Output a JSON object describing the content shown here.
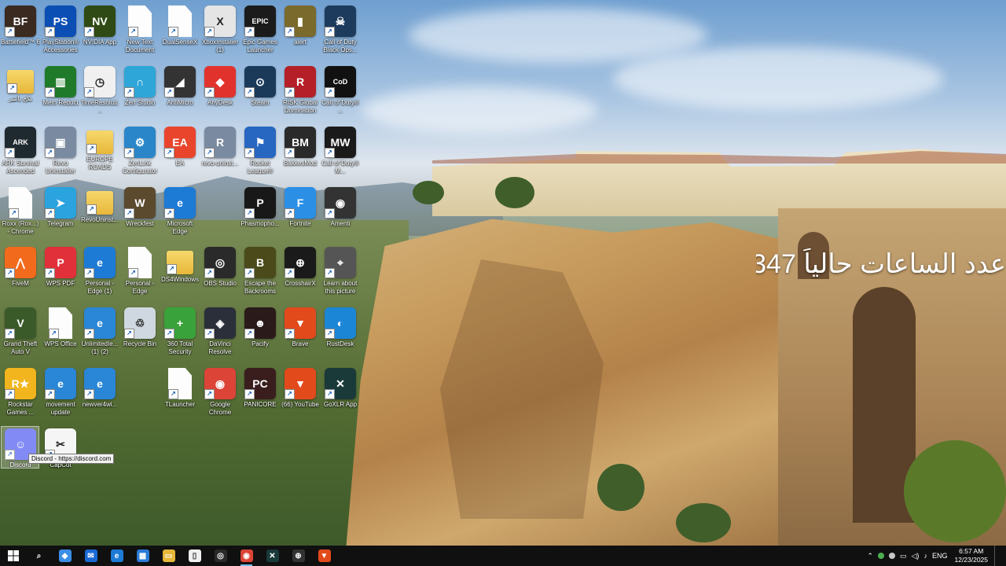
{
  "overlay_text": "عدد الساعات حالياً 347",
  "tooltip": "Discord - https://discord.com",
  "desktop_icons": [
    {
      "label": "Battlefield™ 6",
      "color": "#3a2a20",
      "glyph": "BF",
      "col": 0,
      "row": 0
    },
    {
      "label": "PlayStation® Accessories",
      "color": "#0b4fb5",
      "glyph": "PS",
      "col": 1,
      "row": 0
    },
    {
      "label": "NVIDIA App",
      "color": "#2f4a14",
      "glyph": "NV",
      "col": 2,
      "row": 0
    },
    {
      "label": "New Text Document",
      "color": "doc",
      "glyph": "",
      "col": 3,
      "row": 0
    },
    {
      "label": "DualSenseX",
      "color": "doc",
      "glyph": "",
      "col": 4,
      "row": 0
    },
    {
      "label": "XboxInstaller (1)",
      "color": "#e5e5e5",
      "glyph": "X",
      "col": 5,
      "row": 0
    },
    {
      "label": "Epic Games Launcher",
      "color": "#1b1b1b",
      "glyph": "EPIC",
      "col": 6,
      "row": 0
    },
    {
      "label": "alert",
      "color": "#7a6a2b",
      "glyph": "▮",
      "col": 7,
      "row": 0
    },
    {
      "label": "Call of Duty Black Ops...",
      "color": "#1d3b5c",
      "glyph": "☠",
      "col": 8,
      "row": 0
    },
    {
      "label": "بكج باشر",
      "color": "folder",
      "glyph": "",
      "col": 0,
      "row": 1
    },
    {
      "label": "Mem Reduct",
      "color": "#1f7a2a",
      "glyph": "▥",
      "col": 1,
      "row": 1
    },
    {
      "label": "TimeResoluti...",
      "color": "#f0f0f0",
      "glyph": "◷",
      "col": 2,
      "row": 1
    },
    {
      "label": "Zen Studio",
      "color": "#2fa6d8",
      "glyph": "∩",
      "col": 3,
      "row": 1
    },
    {
      "label": "AntiMicro",
      "color": "#333333",
      "glyph": "◢",
      "col": 4,
      "row": 1
    },
    {
      "label": "AnyDesk",
      "color": "#e2322e",
      "glyph": "◆",
      "col": 5,
      "row": 1
    },
    {
      "label": "Steam",
      "color": "#1b3a5a",
      "glyph": "⊙",
      "col": 6,
      "row": 1
    },
    {
      "label": "RISK Global Domination",
      "color": "#b51f27",
      "glyph": "R",
      "col": 7,
      "row": 1
    },
    {
      "label": "Call of Duty® ...",
      "color": "#111111",
      "glyph": "CoD",
      "col": 8,
      "row": 1
    },
    {
      "label": "ARK Survival Ascended",
      "color": "#1e2a30",
      "glyph": "ARK",
      "col": 0,
      "row": 2
    },
    {
      "label": "Revo Uninstaller",
      "color": "#7a8aa0",
      "glyph": "▣",
      "col": 1,
      "row": 2
    },
    {
      "label": "EUROPE ROADS",
      "color": "folder",
      "glyph": "",
      "col": 2,
      "row": 2
    },
    {
      "label": "ZenLink Configurator",
      "color": "#2a86c9",
      "glyph": "⚙",
      "col": 3,
      "row": 2
    },
    {
      "label": "EA",
      "color": "#e8452c",
      "glyph": "EA",
      "col": 4,
      "row": 2
    },
    {
      "label": "revo-uninst...",
      "color": "#7a8aa0",
      "glyph": "R",
      "col": 5,
      "row": 2
    },
    {
      "label": "Rocket League®",
      "color": "#2767c2",
      "glyph": "⚑",
      "col": 6,
      "row": 2
    },
    {
      "label": "BakkesMod",
      "color": "#2a2a2a",
      "glyph": "BM",
      "col": 7,
      "row": 2
    },
    {
      "label": "Call of Duty® M...",
      "color": "#1a1a1a",
      "glyph": "MW",
      "col": 8,
      "row": 2
    },
    {
      "label": "Roxx (Rox...) - Chrome",
      "color": "doc",
      "glyph": "",
      "col": 0,
      "row": 3
    },
    {
      "label": "Telegram",
      "color": "#2aa3de",
      "glyph": "➤",
      "col": 1,
      "row": 3
    },
    {
      "label": "RevoUninst...",
      "color": "folder",
      "glyph": "",
      "col": 2,
      "row": 3
    },
    {
      "label": "Wreckfest",
      "color": "#5b4a2e",
      "glyph": "W",
      "col": 3,
      "row": 3
    },
    {
      "label": "Microsoft Edge",
      "color": "#1d7bd6",
      "glyph": "e",
      "col": 4,
      "row": 3
    },
    {
      "label": "Phasmopho...",
      "color": "#181818",
      "glyph": "P",
      "col": 6,
      "row": 3
    },
    {
      "label": "Fortnite",
      "color": "#2b8fe6",
      "glyph": "F",
      "col": 7,
      "row": 3
    },
    {
      "label": "Amenti",
      "color": "#333333",
      "glyph": "◉",
      "col": 8,
      "row": 3
    },
    {
      "label": "FiveM",
      "color": "#f26a1b",
      "glyph": "⋀",
      "col": 0,
      "row": 4
    },
    {
      "label": "WPS PDF",
      "color": "#e2303b",
      "glyph": "P",
      "col": 1,
      "row": 4
    },
    {
      "label": "Personal - Edge (1)",
      "color": "#1d7bd6",
      "glyph": "e",
      "col": 2,
      "row": 4
    },
    {
      "label": "Personal - Edge",
      "color": "doc",
      "glyph": "",
      "col": 3,
      "row": 4
    },
    {
      "label": "DS4Windows",
      "color": "folder",
      "glyph": "",
      "col": 4,
      "row": 4
    },
    {
      "label": "OBS Studio",
      "color": "#2a2a2a",
      "glyph": "◎",
      "col": 5,
      "row": 4
    },
    {
      "label": "Escape the Backrooms",
      "color": "#4a4a1a",
      "glyph": "B",
      "col": 6,
      "row": 4
    },
    {
      "label": "CrosshairX",
      "color": "#1a1a1a",
      "glyph": "⊕",
      "col": 7,
      "row": 4
    },
    {
      "label": "Learn about this picture",
      "color": "#555555",
      "glyph": "⌖",
      "col": 8,
      "row": 4
    },
    {
      "label": "Grand Theft Auto V",
      "color": "#3a5a2a",
      "glyph": "V",
      "col": 0,
      "row": 5
    },
    {
      "label": "WPS Office",
      "color": "doc",
      "glyph": "",
      "col": 1,
      "row": 5
    },
    {
      "label": "UnlimitedIe... (1) (2)",
      "color": "#2a86d6",
      "glyph": "e",
      "col": 2,
      "row": 5
    },
    {
      "label": "Recycle Bin",
      "color": "#cfd8e0",
      "glyph": "♲",
      "col": 3,
      "row": 5
    },
    {
      "label": "360 Total Security",
      "color": "#3aa23a",
      "glyph": "+",
      "col": 4,
      "row": 5
    },
    {
      "label": "DaVinci Resolve",
      "color": "#2a2f3a",
      "glyph": "◈",
      "col": 5,
      "row": 5
    },
    {
      "label": "Pacify",
      "color": "#2a1a1a",
      "glyph": "☻",
      "col": 6,
      "row": 5
    },
    {
      "label": "Brave",
      "color": "#e24a1c",
      "glyph": "▼",
      "col": 7,
      "row": 5
    },
    {
      "label": "RustDesk",
      "color": "#1c86d6",
      "glyph": "◐",
      "col": 8,
      "row": 5
    },
    {
      "label": "Rockstar Games ...",
      "color": "#f2b51d",
      "glyph": "R★",
      "col": 0,
      "row": 6
    },
    {
      "label": "movement update",
      "color": "#2a86d6",
      "glyph": "e",
      "col": 1,
      "row": 6
    },
    {
      "label": "newver4wi...",
      "color": "#2a86d6",
      "glyph": "e",
      "col": 2,
      "row": 6
    },
    {
      "label": "TLauncher",
      "color": "doc",
      "glyph": "",
      "col": 4,
      "row": 6
    },
    {
      "label": "Google Chrome",
      "color": "#db4437",
      "glyph": "◉",
      "col": 5,
      "row": 6
    },
    {
      "label": "PANICORE",
      "color": "#3a1e1e",
      "glyph": "PC",
      "col": 6,
      "row": 6
    },
    {
      "label": "(66) YouTube",
      "color": "#e24a1c",
      "glyph": "▼",
      "col": 7,
      "row": 6
    },
    {
      "label": "GoXLR App",
      "color": "#1a3a3a",
      "glyph": "✕",
      "col": 8,
      "row": 6
    },
    {
      "label": "Discord",
      "color": "#5865f2",
      "glyph": "☺",
      "col": 0,
      "row": 7
    },
    {
      "label": "CapCut",
      "color": "#f5f5f5",
      "glyph": "✂",
      "col": 1,
      "row": 7
    }
  ],
  "taskbar": {
    "start_icon": "windows-logo-icon",
    "items": [
      {
        "name": "search-icon",
        "glyph": "⌕",
        "color": "transparent",
        "running": false
      },
      {
        "name": "copilot-icon",
        "glyph": "◆",
        "color": "#3a8ee6",
        "running": false
      },
      {
        "name": "mail-icon",
        "glyph": "✉",
        "color": "#1a6ad6",
        "running": false
      },
      {
        "name": "edge-icon",
        "glyph": "e",
        "color": "#1d7bd6",
        "running": false
      },
      {
        "name": "store-icon",
        "glyph": "▦",
        "color": "#2a7bd6",
        "running": false
      },
      {
        "name": "file-explorer-icon",
        "glyph": "▭",
        "color": "#e7b73a",
        "running": false
      },
      {
        "name": "document-icon",
        "glyph": "▯",
        "color": "#f0f0f0",
        "running": false
      },
      {
        "name": "obs-icon",
        "glyph": "◎",
        "color": "#2a2a2a",
        "running": false
      },
      {
        "name": "chrome-icon",
        "glyph": "◉",
        "color": "#db4437",
        "running": true
      },
      {
        "name": "goxlr-icon",
        "glyph": "✕",
        "color": "#1a3a3a",
        "running": false
      },
      {
        "name": "crosshair-icon",
        "glyph": "⊕",
        "color": "#333333",
        "running": false
      },
      {
        "name": "brave-icon",
        "glyph": "▼",
        "color": "#e24a1c",
        "running": false
      }
    ],
    "tray": {
      "language": "ENG",
      "time": "6:57 AM",
      "date": "12/23/2025"
    }
  }
}
